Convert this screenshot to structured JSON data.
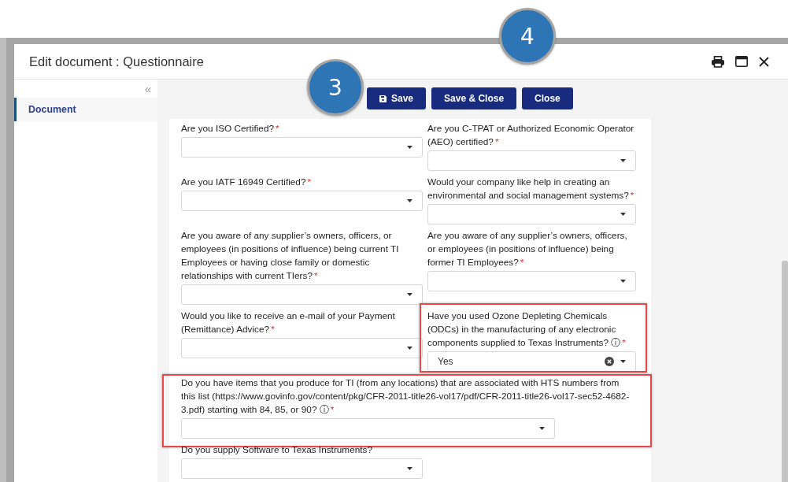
{
  "dialog": {
    "title": "Edit document : Questionnaire"
  },
  "sidebar": {
    "collapse_glyph": "«",
    "items": [
      {
        "label": "Document",
        "selected": true
      }
    ]
  },
  "toolbar": {
    "buttons": [
      {
        "label": "Save",
        "kind": "save"
      },
      {
        "label": "Save & Close",
        "kind": "plain"
      },
      {
        "label": "Close",
        "kind": "plain"
      }
    ]
  },
  "form": {
    "fields": [
      {
        "label": "Are you ISO Certified?",
        "required_mark": "*",
        "kind": "half",
        "highlighted": false
      },
      {
        "label": "Are you C-TPAT or Authorized Economic Operator (AEO) certified?",
        "required_mark": "*",
        "kind": "half",
        "highlighted": false
      },
      {
        "label": "Are you IATF 16949 Certified?",
        "required_mark": "*",
        "kind": "half",
        "highlighted": false
      },
      {
        "label": "Would your company like help in creating an environmental and social management systems?",
        "required_mark": "*",
        "kind": "half",
        "highlighted": false
      },
      {
        "label": "Are you aware of any supplier’s owners, officers, or employees (in positions of influence) being current TI Employees or having close family or domestic relationships with current TIers?",
        "required_mark": "*",
        "kind": "half",
        "highlighted": false
      },
      {
        "label": "Are you aware of any supplier’s owners, officers, or employees (in positions of influence) being former TI Employees?",
        "required_mark": "*",
        "kind": "half",
        "highlighted": false
      },
      {
        "label": "Would you like to receive an e-mail of your Payment (Remittance) Advice?",
        "required_mark": "*",
        "kind": "half",
        "highlighted": false
      },
      {
        "label": "Have you used Ozone Depleting Chemicals (ODCs) in the manufacturing of any electronic components supplied to Texas Instruments? ⓘ",
        "required_mark": "*",
        "kind": "half",
        "highlighted": true,
        "value": "Yes"
      },
      {
        "label": "Do you have items that you produce for TI (from any locations) that are associated with HTS numbers from this list (https://www.govinfo.gov/content/pkg/CFR-2011-title26-vol17/pdf/CFR-2011-title26-vol17-sec52-4682-3.pdf) starting with 84, 85, or 90? ⓘ",
        "required_mark": "*",
        "kind": "full",
        "highlighted": true
      },
      {
        "label": "Do you supply Software to Texas Instruments?",
        "kind": "half",
        "highlighted": false
      }
    ]
  },
  "callouts": [
    {
      "number": "3"
    },
    {
      "number": "4"
    }
  ]
}
